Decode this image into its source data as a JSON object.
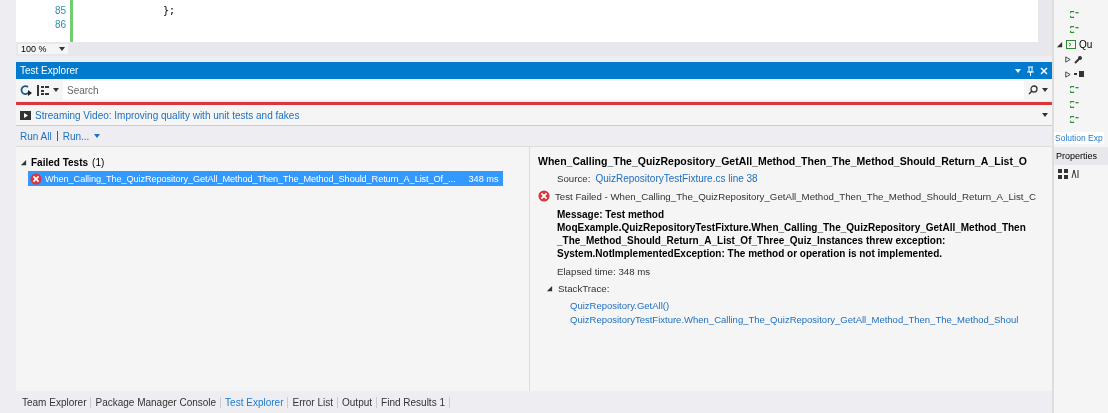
{
  "editor": {
    "lines": [
      {
        "number": "85",
        "code": "};"
      },
      {
        "number": "86"
      }
    ]
  },
  "zoom": "100 %",
  "panel": {
    "title": "Test Explorer"
  },
  "search": {
    "placeholder": "Search"
  },
  "banner": {
    "link": "Streaming Video: Improving quality with unit tests and fakes"
  },
  "run_links": [
    "Run All",
    "Run..."
  ],
  "test_groups": [
    {
      "label": "Failed Tests",
      "count": "(1)",
      "expanded": true,
      "tests": [
        {
          "name": "When_Calling_The_QuizRepository_GetAll_Method_Then_The_Method_Should_Return_A_List_Of_...",
          "duration": "348 ms",
          "selected": true
        }
      ]
    }
  ],
  "detail": {
    "title": "When_Calling_The_QuizRepository_GetAll_Method_Then_The_Method_Should_Return_A_List_O",
    "source_label": "Source:",
    "source_link": "QuizRepositoryTestFixture.cs line 38",
    "result": "Test Failed - When_Calling_The_QuizRepository_GetAll_Method_Then_The_Method_Should_Return_A_List_C",
    "message": "Message: Test method MoqExample.QuizRepositoryTestFixture.When_Calling_The_QuizRepository_GetAll_Method_Then_The_Method_Should_Return_A_List_Of_Three_Quiz_Instances threw exception: System.NotImplementedException: The method or operation is not implemented.",
    "elapsed": "Elapsed time: 348 ms",
    "stack_trace": {
      "label": "StackTrace:",
      "expanded": true,
      "frames": [
        "QuizRepository.GetAll()",
        "QuizRepositoryTestFixture.When_Calling_The_QuizRepository_GetAll_Method_Then_The_Method_Shoul"
      ]
    }
  },
  "bottom_tabs": [
    {
      "label": "Team Explorer",
      "selected": false
    },
    {
      "label": "Package Manager Console",
      "selected": false
    },
    {
      "label": "Test Explorer",
      "selected": true
    },
    {
      "label": "Error List",
      "selected": false
    },
    {
      "label": "Output",
      "selected": false
    },
    {
      "label": "Find Results 1",
      "selected": false
    }
  ],
  "side_panel": {
    "tree_label": "Qu",
    "tab": "Solution Exp",
    "properties_title": "Properties"
  }
}
